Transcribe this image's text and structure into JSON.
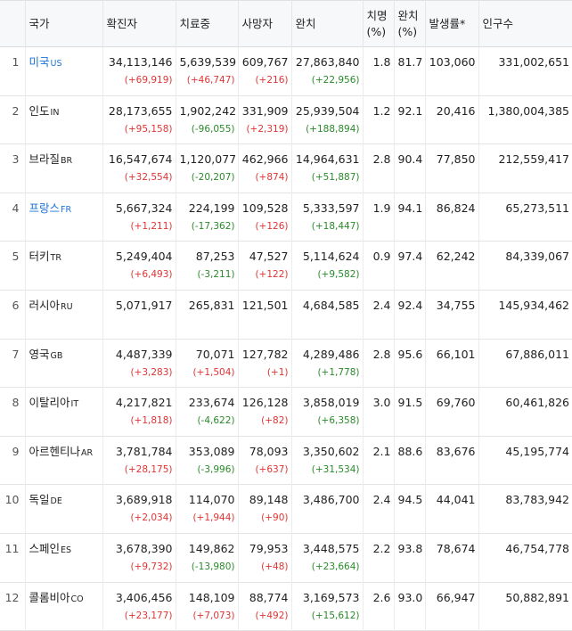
{
  "headers": {
    "country": "국가",
    "confirmed": "확진자",
    "treating": "치료중",
    "deaths": "사망자",
    "recovered": "완치",
    "fatality_l1": "치명",
    "fatality_l2": "(%)",
    "recovery_l1": "완치",
    "recovery_l2": "(%)",
    "incidence": "발생률*",
    "population": "인구수"
  },
  "colors": {
    "link": "#1a73d9",
    "increase": "#e03434",
    "decrease": "#2a8a2a"
  },
  "rows": [
    {
      "rank": "1",
      "name": "미국",
      "code": "US",
      "link": true,
      "confirmed": "34,113,146",
      "confirmed_delta": "(+69,919)",
      "treating": "5,639,539",
      "treating_delta": "(+46,747)",
      "treating_dir": "up",
      "deaths": "609,767",
      "deaths_delta": "(+216)",
      "recovered": "27,863,840",
      "recovered_delta": "(+22,956)",
      "fatality": "1.8",
      "recovery": "81.7",
      "incidence": "103,060",
      "population": "331,002,651"
    },
    {
      "rank": "2",
      "name": "인도",
      "code": "IN",
      "link": false,
      "confirmed": "28,173,655",
      "confirmed_delta": "(+95,158)",
      "treating": "1,902,242",
      "treating_delta": "(-96,055)",
      "treating_dir": "down",
      "deaths": "331,909",
      "deaths_delta": "(+2,319)",
      "recovered": "25,939,504",
      "recovered_delta": "(+188,894)",
      "fatality": "1.2",
      "recovery": "92.1",
      "incidence": "20,416",
      "population": "1,380,004,385"
    },
    {
      "rank": "3",
      "name": "브라질",
      "code": "BR",
      "link": false,
      "confirmed": "16,547,674",
      "confirmed_delta": "(+32,554)",
      "treating": "1,120,077",
      "treating_delta": "(-20,207)",
      "treating_dir": "down",
      "deaths": "462,966",
      "deaths_delta": "(+874)",
      "recovered": "14,964,631",
      "recovered_delta": "(+51,887)",
      "fatality": "2.8",
      "recovery": "90.4",
      "incidence": "77,850",
      "population": "212,559,417"
    },
    {
      "rank": "4",
      "name": "프랑스",
      "code": "FR",
      "link": true,
      "confirmed": "5,667,324",
      "confirmed_delta": "(+1,211)",
      "treating": "224,199",
      "treating_delta": "(-17,362)",
      "treating_dir": "down",
      "deaths": "109,528",
      "deaths_delta": "(+126)",
      "recovered": "5,333,597",
      "recovered_delta": "(+18,447)",
      "fatality": "1.9",
      "recovery": "94.1",
      "incidence": "86,824",
      "population": "65,273,511"
    },
    {
      "rank": "5",
      "name": "터키",
      "code": "TR",
      "link": false,
      "confirmed": "5,249,404",
      "confirmed_delta": "(+6,493)",
      "treating": "87,253",
      "treating_delta": "(-3,211)",
      "treating_dir": "down",
      "deaths": "47,527",
      "deaths_delta": "(+122)",
      "recovered": "5,114,624",
      "recovered_delta": "(+9,582)",
      "fatality": "0.9",
      "recovery": "97.4",
      "incidence": "62,242",
      "population": "84,339,067"
    },
    {
      "rank": "6",
      "name": "러시아",
      "code": "RU",
      "link": false,
      "confirmed": "5,071,917",
      "confirmed_delta": "",
      "treating": "265,831",
      "treating_delta": "",
      "treating_dir": "up",
      "deaths": "121,501",
      "deaths_delta": "",
      "recovered": "4,684,585",
      "recovered_delta": "",
      "fatality": "2.4",
      "recovery": "92.4",
      "incidence": "34,755",
      "population": "145,934,462"
    },
    {
      "rank": "7",
      "name": "영국",
      "code": "GB",
      "link": false,
      "confirmed": "4,487,339",
      "confirmed_delta": "(+3,283)",
      "treating": "70,071",
      "treating_delta": "(+1,504)",
      "treating_dir": "up",
      "deaths": "127,782",
      "deaths_delta": "(+1)",
      "recovered": "4,289,486",
      "recovered_delta": "(+1,778)",
      "fatality": "2.8",
      "recovery": "95.6",
      "incidence": "66,101",
      "population": "67,886,011"
    },
    {
      "rank": "8",
      "name": "이탈리아",
      "code": "IT",
      "link": false,
      "confirmed": "4,217,821",
      "confirmed_delta": "(+1,818)",
      "treating": "233,674",
      "treating_delta": "(-4,622)",
      "treating_dir": "down",
      "deaths": "126,128",
      "deaths_delta": "(+82)",
      "recovered": "3,858,019",
      "recovered_delta": "(+6,358)",
      "fatality": "3.0",
      "recovery": "91.5",
      "incidence": "69,760",
      "population": "60,461,826"
    },
    {
      "rank": "9",
      "name": "아르헨티나",
      "code": "AR",
      "link": false,
      "confirmed": "3,781,784",
      "confirmed_delta": "(+28,175)",
      "treating": "353,089",
      "treating_delta": "(-3,996)",
      "treating_dir": "down",
      "deaths": "78,093",
      "deaths_delta": "(+637)",
      "recovered": "3,350,602",
      "recovered_delta": "(+31,534)",
      "fatality": "2.1",
      "recovery": "88.6",
      "incidence": "83,676",
      "population": "45,195,774"
    },
    {
      "rank": "10",
      "name": "독일",
      "code": "DE",
      "link": false,
      "confirmed": "3,689,918",
      "confirmed_delta": "(+2,034)",
      "treating": "114,070",
      "treating_delta": "(+1,944)",
      "treating_dir": "up",
      "deaths": "89,148",
      "deaths_delta": "(+90)",
      "recovered": "3,486,700",
      "recovered_delta": "",
      "fatality": "2.4",
      "recovery": "94.5",
      "incidence": "44,041",
      "population": "83,783,942"
    },
    {
      "rank": "11",
      "name": "스페인",
      "code": "ES",
      "link": false,
      "confirmed": "3,678,390",
      "confirmed_delta": "(+9,732)",
      "treating": "149,862",
      "treating_delta": "(-13,980)",
      "treating_dir": "down",
      "deaths": "79,953",
      "deaths_delta": "(+48)",
      "recovered": "3,448,575",
      "recovered_delta": "(+23,664)",
      "fatality": "2.2",
      "recovery": "93.8",
      "incidence": "78,674",
      "population": "46,754,778"
    },
    {
      "rank": "12",
      "name": "콜롬비아",
      "code": "CO",
      "link": false,
      "confirmed": "3,406,456",
      "confirmed_delta": "(+23,177)",
      "treating": "148,109",
      "treating_delta": "(+7,073)",
      "treating_dir": "up",
      "deaths": "88,774",
      "deaths_delta": "(+492)",
      "recovered": "3,169,573",
      "recovered_delta": "(+15,612)",
      "fatality": "2.6",
      "recovery": "93.0",
      "incidence": "66,947",
      "population": "50,882,891"
    }
  ]
}
